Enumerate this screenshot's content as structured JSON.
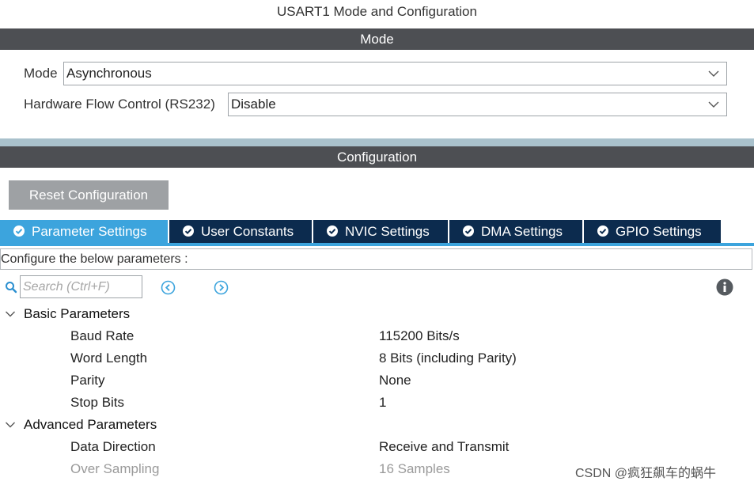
{
  "window": {
    "title": "USART1 Mode and Configuration"
  },
  "mode_section": {
    "header": "Mode",
    "fields": [
      {
        "label": "Mode",
        "value": "Asynchronous"
      },
      {
        "label": "Hardware Flow Control (RS232)",
        "value": "Disable"
      }
    ]
  },
  "config_section": {
    "header": "Configuration",
    "reset_label": "Reset Configuration",
    "tabs": [
      {
        "label": "Parameter Settings",
        "active": true
      },
      {
        "label": "User Constants",
        "active": false
      },
      {
        "label": "NVIC Settings",
        "active": false
      },
      {
        "label": "DMA Settings",
        "active": false
      },
      {
        "label": "GPIO Settings",
        "active": false
      }
    ],
    "description": "Configure the below parameters :",
    "search_placeholder": "Search (Ctrl+F)",
    "groups": [
      {
        "name": "Basic Parameters",
        "params": [
          {
            "name": "Baud Rate",
            "value": "115200 Bits/s",
            "enabled": true
          },
          {
            "name": "Word Length",
            "value": "8 Bits (including Parity)",
            "enabled": true
          },
          {
            "name": "Parity",
            "value": "None",
            "enabled": true
          },
          {
            "name": "Stop Bits",
            "value": "1",
            "enabled": true
          }
        ]
      },
      {
        "name": "Advanced Parameters",
        "params": [
          {
            "name": "Data Direction",
            "value": "Receive and Transmit",
            "enabled": true
          },
          {
            "name": "Over Sampling",
            "value": "16 Samples",
            "enabled": false
          }
        ]
      }
    ]
  },
  "watermark": "CSDN @疯狂飙车的蜗牛",
  "colors": {
    "header_bar": "#4d4f53",
    "tab_active": "#3ca4dd",
    "tab_inactive": "#0c2b4e",
    "accent_icon": "#3ca4dd"
  },
  "icons": {
    "search": "search-icon",
    "prev": "prev-circle-icon",
    "next": "next-circle-icon",
    "info": "info-icon",
    "check": "check-circle-icon",
    "expand": "chevron-down-icon"
  }
}
